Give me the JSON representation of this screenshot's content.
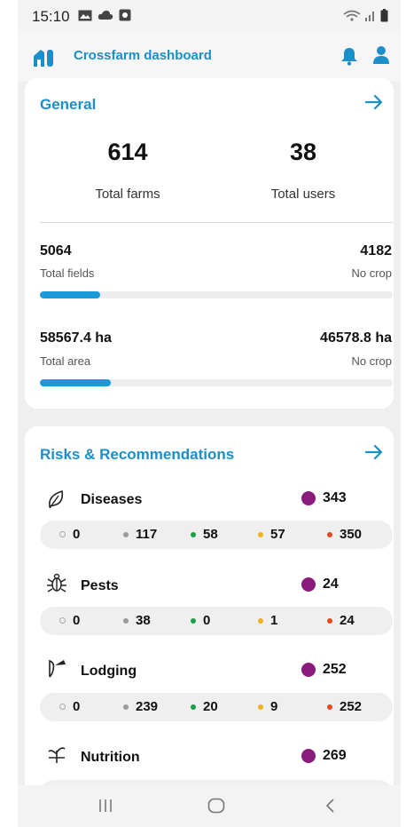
{
  "status_bar": {
    "time": "15:10"
  },
  "app_bar": {
    "title": "Crossfarm dashboard"
  },
  "general": {
    "title": "General",
    "total_farms": {
      "value": "614",
      "label": "Total farms"
    },
    "total_users": {
      "value": "38",
      "label": "Total users"
    },
    "fields": {
      "value": "5064",
      "label": "Total fields",
      "no_crop_value": "4182",
      "no_crop_label": "No crop",
      "progress_fraction": 0.17
    },
    "area": {
      "value": "58567.4 ha",
      "label": "Total area",
      "no_crop_value": "46578.8 ha",
      "no_crop_label": "No crop",
      "progress_fraction": 0.2
    }
  },
  "risks": {
    "title": "Risks & Recommendations",
    "items": [
      {
        "name": "Diseases",
        "icon": "leaf-icon",
        "total": "343",
        "counts": [
          "0",
          "117",
          "58",
          "57",
          "350"
        ]
      },
      {
        "name": "Pests",
        "icon": "bug-icon",
        "total": "24",
        "counts": [
          "0",
          "38",
          "0",
          "1",
          "24"
        ]
      },
      {
        "name": "Lodging",
        "icon": "lodging-icon",
        "total": "252",
        "counts": [
          "0",
          "239",
          "20",
          "9",
          "252"
        ]
      },
      {
        "name": "Nutrition",
        "icon": "sprout-icon",
        "total": "269",
        "counts": []
      }
    ]
  },
  "colors": {
    "accent": "#1a8fc9",
    "purple": "#8a1c7e",
    "green": "#19a049",
    "yellow": "#f2b21b",
    "red": "#e74820",
    "grey": "#9a9a9a"
  }
}
